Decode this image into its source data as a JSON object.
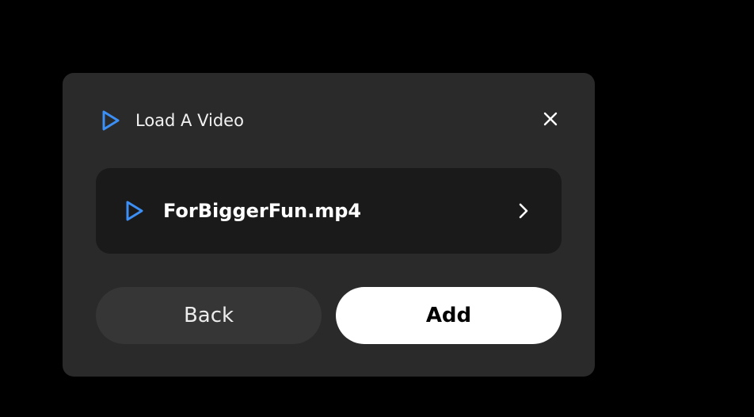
{
  "dialog": {
    "title": "Load A Video",
    "title_icon": "play-outline-icon",
    "close_icon": "close-icon",
    "file": {
      "name": "ForBiggerFun.mp4",
      "icon": "play-outline-icon",
      "chevron_icon": "chevron-right-icon"
    },
    "buttons": {
      "back_label": "Back",
      "add_label": "Add"
    }
  },
  "colors": {
    "background": "#000000",
    "dialog_bg": "#2a2a2a",
    "file_row_bg": "#1a1a1a",
    "accent_blue": "#3b8ff5",
    "back_button_bg": "#363636",
    "add_button_bg": "#ffffff"
  }
}
